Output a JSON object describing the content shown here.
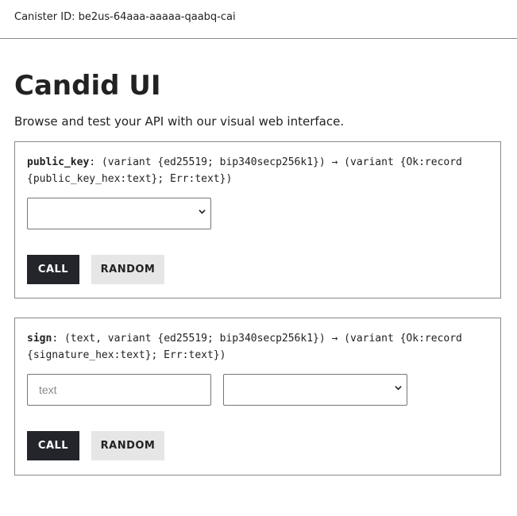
{
  "header": {
    "canister_label": "Canister ID: be2us-64aaa-aaaaa-qaabq-cai"
  },
  "page": {
    "title": "Candid UI",
    "subtitle": "Browse and test your API with our visual web interface."
  },
  "methods": [
    {
      "name": "public_key",
      "signature": ": (variant {ed25519; bip340secp256k1}) → (variant {Ok:record {public_key_hex:text}; Err:text})",
      "select_value": "",
      "call_label": "CALL",
      "random_label": "RANDOM"
    },
    {
      "name": "sign",
      "signature": ": (text, variant {ed25519; bip340secp256k1}) → (variant {Ok:record {signature_hex:text}; Err:text})",
      "text_placeholder": "text",
      "select_value": "",
      "call_label": "CALL",
      "random_label": "RANDOM"
    }
  ],
  "icons": {
    "select_arrow": "chevron-down-icon"
  },
  "colors": {
    "call_button_bg": "#23252b",
    "random_button_bg": "#e6e6e6"
  }
}
